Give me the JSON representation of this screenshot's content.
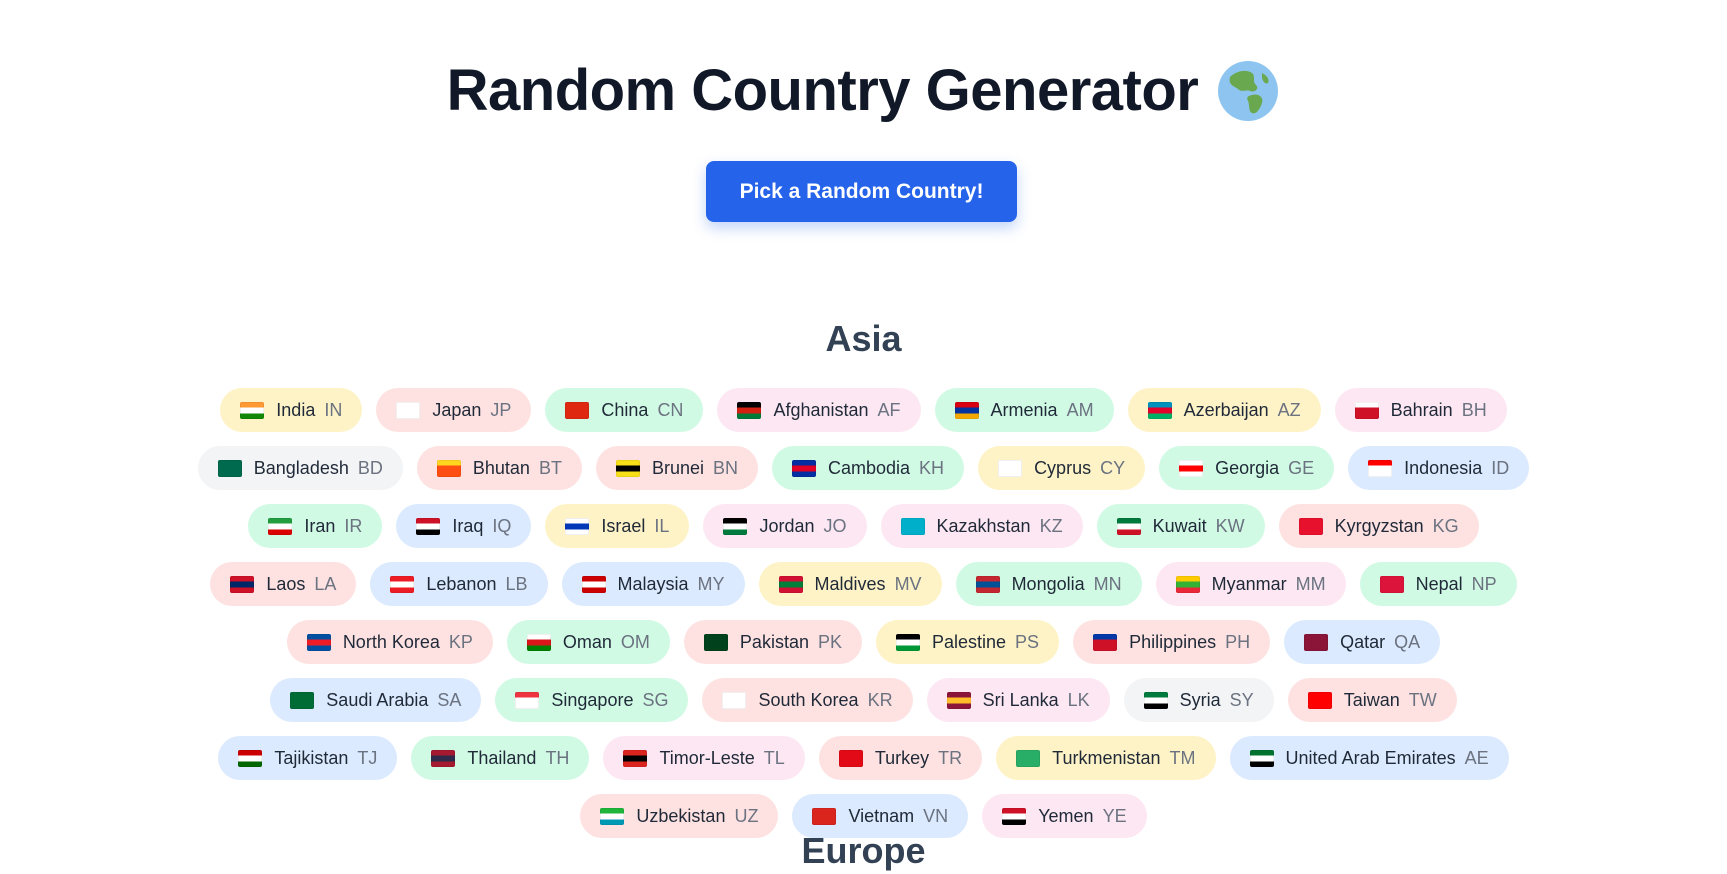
{
  "header": {
    "title": "Random Country Generator"
  },
  "actions": {
    "pick_label": "Pick a Random Country!"
  },
  "regions": [
    {
      "name": "Asia",
      "countries": [
        {
          "name": "India",
          "code": "IN",
          "bg": "yellow",
          "flag": [
            "#ff9933",
            "#ffffff",
            "#138808"
          ]
        },
        {
          "name": "Japan",
          "code": "JP",
          "bg": "red",
          "flag": [
            "#ffffff",
            "#ffffff",
            "#ffffff"
          ]
        },
        {
          "name": "China",
          "code": "CN",
          "bg": "green",
          "flag": [
            "#de2910",
            "#de2910",
            "#de2910"
          ]
        },
        {
          "name": "Afghanistan",
          "code": "AF",
          "bg": "pink",
          "flag": [
            "#000000",
            "#d32011",
            "#007a36"
          ]
        },
        {
          "name": "Armenia",
          "code": "AM",
          "bg": "green",
          "flag": [
            "#d90012",
            "#0033a0",
            "#f2a800"
          ]
        },
        {
          "name": "Azerbaijan",
          "code": "AZ",
          "bg": "yellow",
          "flag": [
            "#0092bc",
            "#e4002b",
            "#00af66"
          ]
        },
        {
          "name": "Bahrain",
          "code": "BH",
          "bg": "pink",
          "flag": [
            "#ffffff",
            "#ce1126",
            "#ce1126"
          ]
        },
        {
          "name": "Bangladesh",
          "code": "BD",
          "bg": "gray",
          "flag": [
            "#006a4e",
            "#006a4e",
            "#006a4e"
          ]
        },
        {
          "name": "Bhutan",
          "code": "BT",
          "bg": "red",
          "flag": [
            "#ffd520",
            "#ff4e12",
            "#ff4e12"
          ]
        },
        {
          "name": "Brunei",
          "code": "BN",
          "bg": "red",
          "flag": [
            "#f7e017",
            "#000000",
            "#f7e017"
          ]
        },
        {
          "name": "Cambodia",
          "code": "KH",
          "bg": "green",
          "flag": [
            "#032ea1",
            "#e00025",
            "#032ea1"
          ]
        },
        {
          "name": "Cyprus",
          "code": "CY",
          "bg": "yellow",
          "flag": [
            "#ffffff",
            "#ffffff",
            "#ffffff"
          ]
        },
        {
          "name": "Georgia",
          "code": "GE",
          "bg": "green",
          "flag": [
            "#ffffff",
            "#ff0000",
            "#ffffff"
          ]
        },
        {
          "name": "Indonesia",
          "code": "ID",
          "bg": "blue",
          "flag": [
            "#ff0000",
            "#ffffff",
            "#ffffff"
          ]
        },
        {
          "name": "Iran",
          "code": "IR",
          "bg": "green",
          "flag": [
            "#239f40",
            "#ffffff",
            "#da0000"
          ]
        },
        {
          "name": "Iraq",
          "code": "IQ",
          "bg": "blue",
          "flag": [
            "#ce1126",
            "#ffffff",
            "#000000"
          ]
        },
        {
          "name": "Israel",
          "code": "IL",
          "bg": "yellow",
          "flag": [
            "#ffffff",
            "#0038b8",
            "#ffffff"
          ]
        },
        {
          "name": "Jordan",
          "code": "JO",
          "bg": "pink",
          "flag": [
            "#000000",
            "#ffffff",
            "#007a3d"
          ]
        },
        {
          "name": "Kazakhstan",
          "code": "KZ",
          "bg": "pink",
          "flag": [
            "#00afca",
            "#00afca",
            "#00afca"
          ]
        },
        {
          "name": "Kuwait",
          "code": "KW",
          "bg": "green",
          "flag": [
            "#007a3d",
            "#ffffff",
            "#ce1126"
          ]
        },
        {
          "name": "Kyrgyzstan",
          "code": "KG",
          "bg": "red",
          "flag": [
            "#e8112d",
            "#e8112d",
            "#e8112d"
          ]
        },
        {
          "name": "Laos",
          "code": "LA",
          "bg": "red",
          "flag": [
            "#ce1126",
            "#002868",
            "#ce1126"
          ]
        },
        {
          "name": "Lebanon",
          "code": "LB",
          "bg": "blue",
          "flag": [
            "#ed1c24",
            "#ffffff",
            "#ed1c24"
          ]
        },
        {
          "name": "Malaysia",
          "code": "MY",
          "bg": "blue",
          "flag": [
            "#cc0001",
            "#ffffff",
            "#cc0001"
          ]
        },
        {
          "name": "Maldives",
          "code": "MV",
          "bg": "yellow",
          "flag": [
            "#d21034",
            "#007e3a",
            "#d21034"
          ]
        },
        {
          "name": "Mongolia",
          "code": "MN",
          "bg": "green",
          "flag": [
            "#c4272f",
            "#015197",
            "#c4272f"
          ]
        },
        {
          "name": "Myanmar",
          "code": "MM",
          "bg": "pink",
          "flag": [
            "#fecb00",
            "#34b233",
            "#ea2839"
          ]
        },
        {
          "name": "Nepal",
          "code": "NP",
          "bg": "green",
          "flag": [
            "#dc143c",
            "#dc143c",
            "#dc143c"
          ]
        },
        {
          "name": "North Korea",
          "code": "KP",
          "bg": "red",
          "flag": [
            "#024fa2",
            "#ed1c27",
            "#024fa2"
          ]
        },
        {
          "name": "Oman",
          "code": "OM",
          "bg": "green",
          "flag": [
            "#ffffff",
            "#db161b",
            "#008000"
          ]
        },
        {
          "name": "Pakistan",
          "code": "PK",
          "bg": "red",
          "flag": [
            "#01411c",
            "#01411c",
            "#01411c"
          ]
        },
        {
          "name": "Palestine",
          "code": "PS",
          "bg": "yellow",
          "flag": [
            "#000000",
            "#ffffff",
            "#009736"
          ]
        },
        {
          "name": "Philippines",
          "code": "PH",
          "bg": "red",
          "flag": [
            "#0038a8",
            "#ce1126",
            "#ce1126"
          ]
        },
        {
          "name": "Qatar",
          "code": "QA",
          "bg": "blue",
          "flag": [
            "#8a1538",
            "#8a1538",
            "#8a1538"
          ]
        },
        {
          "name": "Saudi Arabia",
          "code": "SA",
          "bg": "blue",
          "flag": [
            "#006c35",
            "#006c35",
            "#006c35"
          ]
        },
        {
          "name": "Singapore",
          "code": "SG",
          "bg": "green",
          "flag": [
            "#ef3340",
            "#ffffff",
            "#ffffff"
          ]
        },
        {
          "name": "South Korea",
          "code": "KR",
          "bg": "red",
          "flag": [
            "#ffffff",
            "#ffffff",
            "#ffffff"
          ]
        },
        {
          "name": "Sri Lanka",
          "code": "LK",
          "bg": "pink",
          "flag": [
            "#8d153a",
            "#ffbe29",
            "#8d153a"
          ]
        },
        {
          "name": "Syria",
          "code": "SY",
          "bg": "gray",
          "flag": [
            "#007a3d",
            "#ffffff",
            "#000000"
          ]
        },
        {
          "name": "Taiwan",
          "code": "TW",
          "bg": "red",
          "flag": [
            "#fe0000",
            "#fe0000",
            "#fe0000"
          ]
        },
        {
          "name": "Tajikistan",
          "code": "TJ",
          "bg": "blue",
          "flag": [
            "#cc0000",
            "#ffffff",
            "#006600"
          ]
        },
        {
          "name": "Thailand",
          "code": "TH",
          "bg": "green",
          "flag": [
            "#a51931",
            "#2d2a4a",
            "#a51931"
          ]
        },
        {
          "name": "Timor-Leste",
          "code": "TL",
          "bg": "pink",
          "flag": [
            "#dc241f",
            "#000000",
            "#dc241f"
          ]
        },
        {
          "name": "Turkey",
          "code": "TR",
          "bg": "red",
          "flag": [
            "#e30a17",
            "#e30a17",
            "#e30a17"
          ]
        },
        {
          "name": "Turkmenistan",
          "code": "TM",
          "bg": "yellow",
          "flag": [
            "#28ae66",
            "#28ae66",
            "#28ae66"
          ]
        },
        {
          "name": "United Arab Emirates",
          "code": "AE",
          "bg": "blue",
          "flag": [
            "#00732f",
            "#ffffff",
            "#000000"
          ]
        },
        {
          "name": "Uzbekistan",
          "code": "UZ",
          "bg": "red",
          "flag": [
            "#1eb53a",
            "#ffffff",
            "#0099b5"
          ]
        },
        {
          "name": "Vietnam",
          "code": "VN",
          "bg": "blue",
          "flag": [
            "#da251d",
            "#da251d",
            "#da251d"
          ]
        },
        {
          "name": "Yemen",
          "code": "YE",
          "bg": "pink",
          "flag": [
            "#ce1126",
            "#ffffff",
            "#000000"
          ]
        }
      ]
    },
    {
      "name": "Europe",
      "countries": []
    }
  ],
  "colors": {
    "accent": "#2563eb",
    "title": "#111827",
    "heading": "#334155"
  }
}
